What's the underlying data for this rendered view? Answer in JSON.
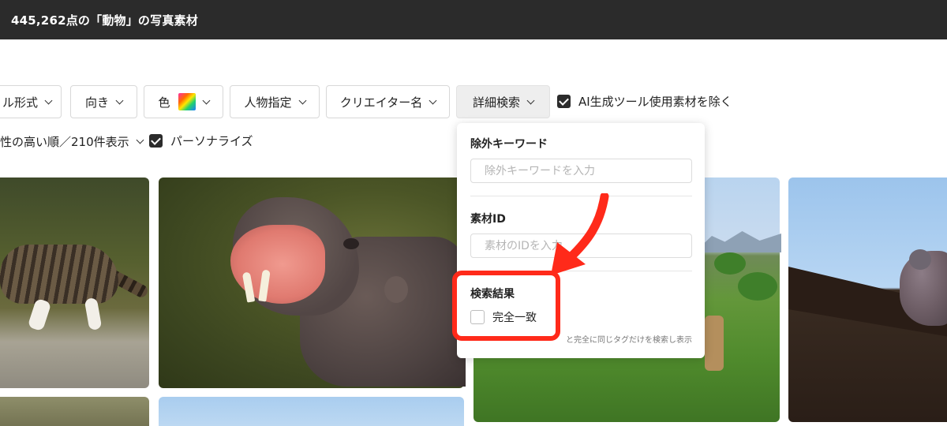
{
  "header": {
    "title": "445,262点の「動物」の写真素材"
  },
  "filters": [
    {
      "label": "ル形式"
    },
    {
      "label": "向き"
    },
    {
      "label": "色"
    },
    {
      "label": "人物指定"
    },
    {
      "label": "クリエイター名"
    },
    {
      "label": "詳細検索"
    }
  ],
  "ai_exclude": {
    "label": "AI生成ツール使用素材を除く",
    "checked": true
  },
  "sort": {
    "label": "性の高い順／210件表示"
  },
  "personalize": {
    "label": "パーソナライズ",
    "checked": true
  },
  "detail_panel": {
    "exclude_keyword": {
      "label": "除外キーワード",
      "placeholder": "除外キーワードを入力"
    },
    "material_id": {
      "label": "素材ID",
      "placeholder": "素材のIDを入力"
    },
    "search_result": {
      "label": "検索結果",
      "exact_match_label": "完全一致",
      "exact_match_checked": false,
      "note": "と完全に同じタグだけを検索し表示"
    }
  },
  "colors": {
    "topbar": "#2b2b2b",
    "highlight": "#ff2a1a",
    "checkbox": "#2b2b2b"
  },
  "icons": {
    "dropdown": "chevron-down-icon",
    "checkbox": "check-icon",
    "color_swatch": "gradient-swatch-icon"
  }
}
